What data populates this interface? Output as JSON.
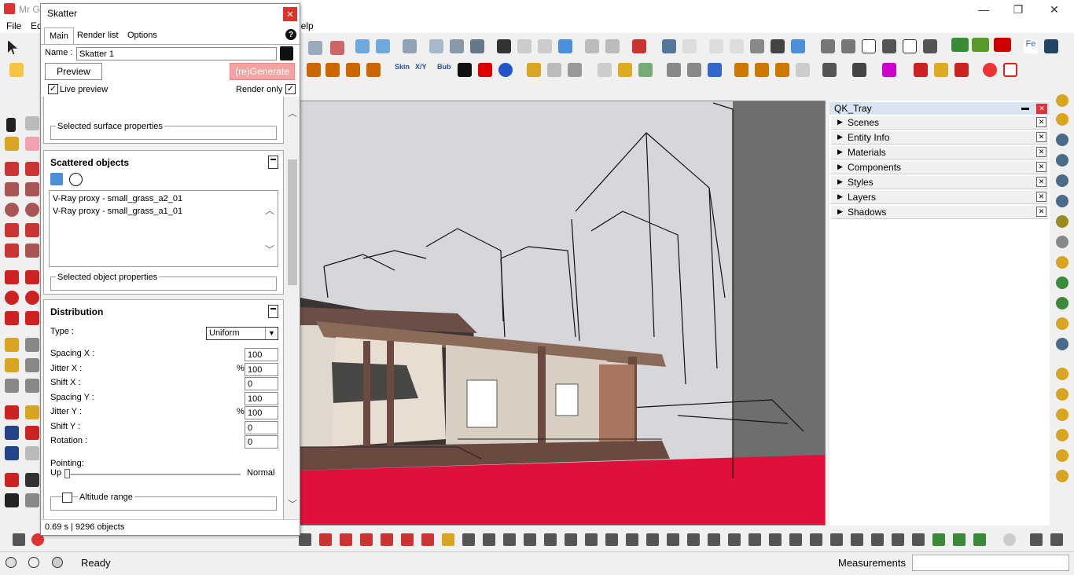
{
  "window": {
    "title_partial": "Mr G",
    "minimize": "—",
    "maximize": "❐",
    "close": "✕"
  },
  "menubar": {
    "file": "File",
    "edit_partial": "Ed",
    "help_partial": "lelp"
  },
  "toolbar": {
    "skin": "Skin",
    "xyz": "X/Y",
    "bub": "Bub"
  },
  "skatter": {
    "title": "Skatter",
    "close": "✕",
    "tabs": [
      "Main",
      "Render list",
      "Options"
    ],
    "active_tab": "Main",
    "help": "?",
    "name_label": "Name :",
    "name_value": "Skatter 1",
    "preview_button": "Preview",
    "generate_button": "(re)Generate",
    "live_preview_label": "Live preview",
    "live_preview_checked": true,
    "render_only_label": "Render only",
    "render_only_checked": true,
    "selected_surface_properties": "Selected surface properties",
    "scattered_objects": {
      "header": "Scattered objects",
      "items": [
        "V-Ray proxy - small_grass_a2_01",
        "V-Ray proxy - small_grass_a1_01"
      ],
      "selected_object_properties": "Selected object properties"
    },
    "distribution": {
      "header": "Distribution",
      "type_label": "Type :",
      "type_value": "Uniform",
      "fields": [
        {
          "label": "Spacing X :",
          "prefix": "",
          "value": "100"
        },
        {
          "label": "Jitter X :",
          "prefix": "%",
          "value": "100"
        },
        {
          "label": "Shift X :",
          "prefix": "",
          "value": "0"
        },
        {
          "label": "Spacing Y :",
          "prefix": "",
          "value": "100"
        },
        {
          "label": "Jitter Y :",
          "prefix": "%",
          "value": "100"
        },
        {
          "label": "Shift Y :",
          "prefix": "",
          "value": "0"
        },
        {
          "label": "Rotation :",
          "prefix": "",
          "value": "0"
        }
      ],
      "pointing_label": "Pointing:",
      "pointing_left": "Up",
      "pointing_right": "Normal",
      "pointing_value": 0.0,
      "altitude_range": "Altitude range"
    },
    "status": "0.69 s | 9296 objects"
  },
  "tray": {
    "title": "QK_Tray",
    "pin": "📌",
    "close": "✕",
    "panels": [
      "Scenes",
      "Entity Info",
      "Materials",
      "Components",
      "Styles",
      "Layers",
      "Shadows"
    ]
  },
  "statusbar": {
    "ready": "Ready",
    "measurements": "Measurements"
  },
  "colors": {
    "ground": "#e0103c",
    "generate_btn": "#f4a3a3",
    "tray_header": "#d8e4f2"
  }
}
